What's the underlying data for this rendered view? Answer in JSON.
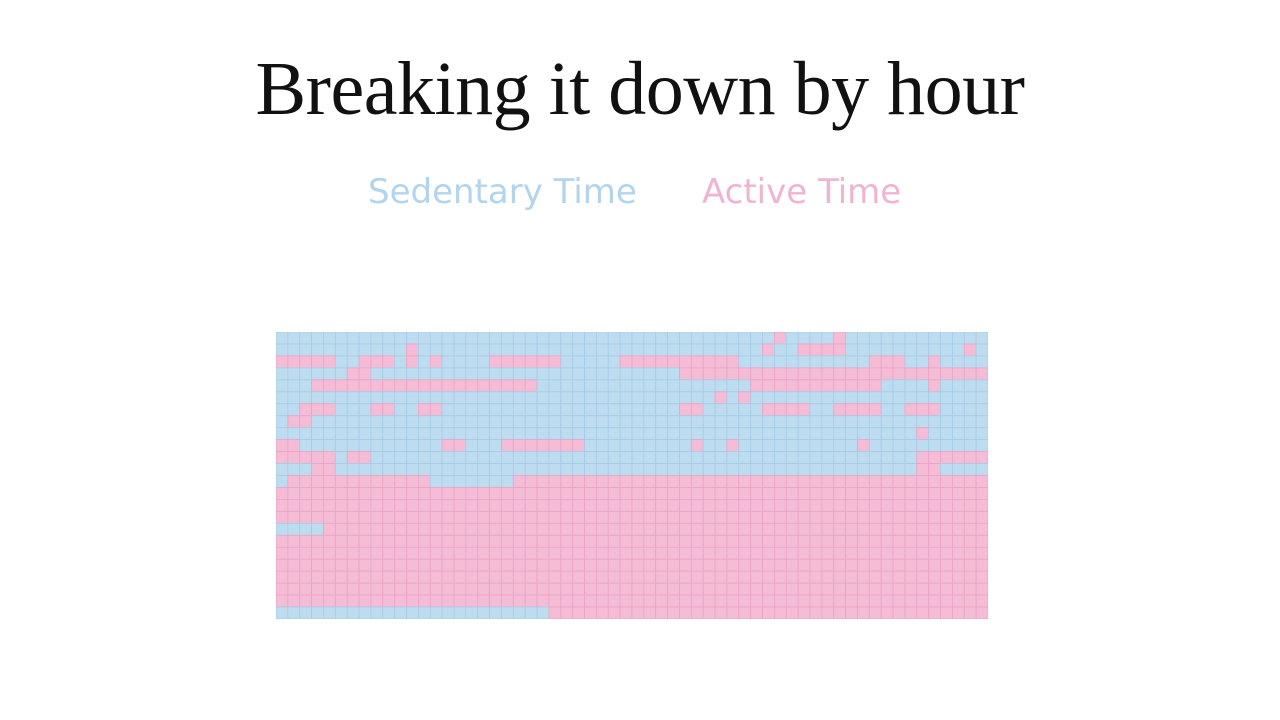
{
  "title": "Breaking it down by hour",
  "legend": {
    "sedentary_label": "Sedentary Time",
    "active_label": "Active Time"
  },
  "colors": {
    "sedentary": "#bddcf0",
    "active": "#f5bcd6",
    "sedentary_line": "#a6cbe6",
    "active_line": "#e9a3c5",
    "sedentary_text": "#b3d4ee",
    "active_text": "#f0b4d3"
  },
  "chart_data": {
    "type": "heatmap",
    "columns": 60,
    "rows": 24,
    "legend": [
      "Sedentary Time",
      "Active Time"
    ],
    "encoding": {
      "S": "Sedentary Time",
      "A": "Active Time"
    },
    "cells": [
      "SSSSSSSSSSSSSSSSSSSSSSSSSSSSSSSSSSSSSSSSSSASSSSASSSSSSSSSSSSS",
      "SSSSSSSSSSSASSSSSSSSSSSSSSSSSSSSSSSSSSSSSASSAAAASSSSSSSSSSASASSSSSSSSSSS",
      "AAAAASSAAASASASSSSAAAAAASSSSSAAAAAAAAAASSSSSSSSSSSAAASSASSSSSSSSSSAAAA",
      "SSSSSSAASSSSSSSSSSSSSSSSSSSSSSSSSSAAAAAAAAAAAAAAAAAAAAAAAAAAAAAA",
      "SSSAAAAAAAAAAAAAAAAAAASSSSSSSSSSSSSSSSSSAAAAAAAAAAASSSSASSSSSSSSSAASSSSSS",
      "SSSSSSSSSSSSSSSSSSSSSSSSSSSSSSSSSSSSSASASSSSSSSSSSSSSSSSSSSSSSSSSSSSS",
      "SSAAASSSAASSAASSSSSSSSSSSSSSSSSSSSAASSSSSAAAASSAAAASSAAASSSSSSSAAAASSSSSSSSS",
      "SAASSSSSSSSSSSSSSSSSSSSSSSSSSSSSSSSSSSSSSSSSSSSSSSSSSSSSSSSSSSASSSSSS",
      "SSSSSSSSSSSSSSSSSSSSSSSSSSSSSSSSSSSSSSSSSSSSSSSSSSSSSSASSSSSAASSSAAAAASSSSSSSSSSSA",
      "AASSSSSSSSSSSSAASSSAAAAAAASSSSSSSSSASSASSSSSSSSSSASSSSSSSSSSSSSSSSS",
      "AAAAASAASSSSSSSSSSSSSSSSSSSSSSSSSSSSSSSSSSSSSSSSSSSSSSAAAAAAAASSA",
      "SSSAASSSSSSSSSSSSSSSSSSSSSSSSSSSSSSSSSSSSSSSSSSSSSSSSSAASSSSSSAA",
      "SAAAAAAAAAAAASSSSSSSAAAAAAAAAAAAAAAAAAAAAAAAAAAAAAAAAAAAAAAAA",
      "AAAAAAAAAAAAAAAAAAAAAAAAAAAAAAAAAAAAAAAAAAAAAAAAAAAAAAAAAAAA",
      "AAAAAAAAAAAAAAAAAAAAAAAAAAAAAAAAAAAAAAAAAAAAAAAAAAAAAAAAAAAA",
      "AAAAAAAAAAAAAAAAAAAAAAAAAAAAAAAAAAAAAAAAAAAAAAAAAAAAAAAAAAAA",
      "SSSSAAAAAAAAAAAAAAAAAAAAAAAAAAAAAAAAAAAAAAAAAAAAAAAAAAAAAAAA",
      "AAAAAAAAAAAAAAAAAAAAAAAAAAAAAAAAAAAAAAAAAAAAAAAAAAAAAAAAAAAA",
      "AAAAAAAAAAAAAAAAAAAAAAAAAAAAAAAAAAAAAAAAAAAAAAAAAAAAAAAAAAAA",
      "AAAAAAAAAAAAAAAAAAAAAAAAAAAAAAAAAAAAAAAAAAAAAAAAAAAAAAAAAAAA",
      "AAAAAAAAAAAAAAAAAAAAAAAAAAAAAAAAAAAAAAAAAAAAAAAAAAAAAAAAAAAA",
      "AAAAAAAAAAAAAAAAAAAAAAAAAAAAAAAAAAAAAAAAAAAAAAAAAAAAAAAAAAAA",
      "AAAAAAAAAAAAAAAAAAAAAAAAAAAAAAAAAAAAAAAAAAAAAAAAAAAAAAAAAAAA",
      "SSSSSSSSSSSSSSSSSSSSSSSAAAAAAAAAAAAAAAAAAAAAAAAAAAAAAAAAAAAA"
    ]
  }
}
